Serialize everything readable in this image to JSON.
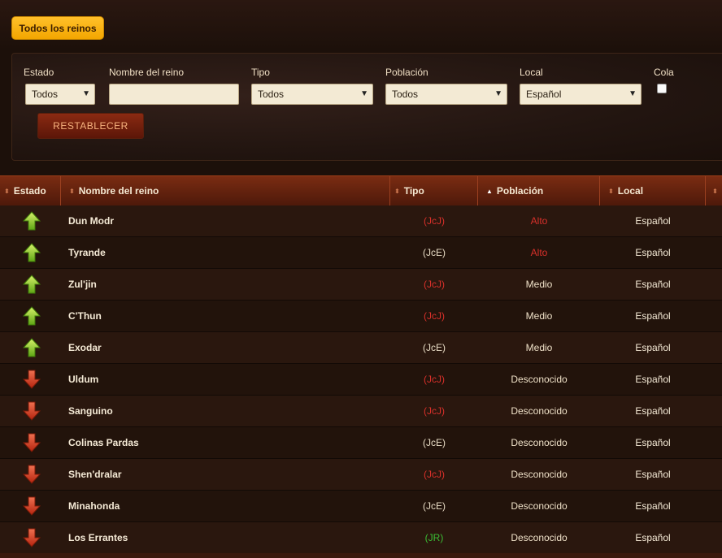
{
  "tab": {
    "label": "Todos los reinos"
  },
  "filters": {
    "estado": {
      "label": "Estado",
      "value": "Todos"
    },
    "nombre": {
      "label": "Nombre del reino",
      "value": ""
    },
    "tipo": {
      "label": "Tipo",
      "value": "Todos"
    },
    "poblacion": {
      "label": "Población",
      "value": "Todos"
    },
    "local": {
      "label": "Local",
      "value": "Español"
    },
    "cola": {
      "label": "Cola",
      "checked": false
    },
    "reset_label": "RESTABLECER"
  },
  "table": {
    "headers": {
      "estado": "Estado",
      "nombre": "Nombre del reino",
      "tipo": "Tipo",
      "poblacion": "Población",
      "local": "Local"
    },
    "rows": [
      {
        "status": "up",
        "name": "Dun Modr",
        "type": "(JcJ)",
        "type_color": "red",
        "pop": "Alto",
        "pop_color": "red",
        "local": "Español"
      },
      {
        "status": "up",
        "name": "Tyrande",
        "type": "(JcE)",
        "type_color": "neutral",
        "pop": "Alto",
        "pop_color": "red",
        "local": "Español"
      },
      {
        "status": "up",
        "name": "Zul'jin",
        "type": "(JcJ)",
        "type_color": "red",
        "pop": "Medio",
        "pop_color": "neutral",
        "local": "Español"
      },
      {
        "status": "up",
        "name": "C'Thun",
        "type": "(JcJ)",
        "type_color": "red",
        "pop": "Medio",
        "pop_color": "neutral",
        "local": "Español"
      },
      {
        "status": "up",
        "name": "Exodar",
        "type": "(JcE)",
        "type_color": "neutral",
        "pop": "Medio",
        "pop_color": "neutral",
        "local": "Español"
      },
      {
        "status": "down",
        "name": "Uldum",
        "type": "(JcJ)",
        "type_color": "red",
        "pop": "Desconocido",
        "pop_color": "neutral",
        "local": "Español"
      },
      {
        "status": "down",
        "name": "Sanguino",
        "type": "(JcJ)",
        "type_color": "red",
        "pop": "Desconocido",
        "pop_color": "neutral",
        "local": "Español"
      },
      {
        "status": "down",
        "name": "Colinas Pardas",
        "type": "(JcE)",
        "type_color": "neutral",
        "pop": "Desconocido",
        "pop_color": "neutral",
        "local": "Español"
      },
      {
        "status": "down",
        "name": "Shen'dralar",
        "type": "(JcJ)",
        "type_color": "red",
        "pop": "Desconocido",
        "pop_color": "neutral",
        "local": "Español"
      },
      {
        "status": "down",
        "name": "Minahonda",
        "type": "(JcE)",
        "type_color": "neutral",
        "pop": "Desconocido",
        "pop_color": "neutral",
        "local": "Español"
      },
      {
        "status": "down",
        "name": "Los Errantes",
        "type": "(JR)",
        "type_color": "green",
        "pop": "Desconocido",
        "pop_color": "neutral",
        "local": "Español"
      }
    ]
  },
  "colors": {
    "tab_accent": "#f3a600",
    "header_bg": "#6a2410",
    "type_red": "#d8302a",
    "type_green": "#3bbd34",
    "arrow_up": "#8fd22a",
    "arrow_down": "#d8402a"
  },
  "icons": {
    "up": "arrow-up-icon",
    "down": "arrow-down-icon",
    "sort": "sort-icon",
    "dropdown": "chevron-down-icon"
  }
}
